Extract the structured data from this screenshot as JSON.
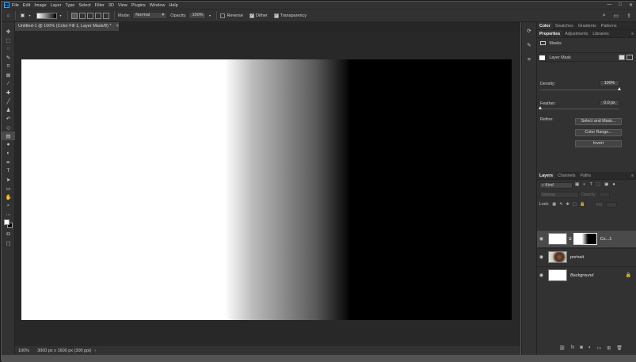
{
  "menu": {
    "logo": "Ps",
    "items": [
      "File",
      "Edit",
      "Image",
      "Layer",
      "Type",
      "Select",
      "Filter",
      "3D",
      "View",
      "Plugins",
      "Window",
      "Help"
    ],
    "window_controls": [
      "—",
      "□",
      "✕"
    ]
  },
  "options": {
    "mode_label": "Mode:",
    "mode_value": "Normal",
    "opacity_label": "Opacity:",
    "opacity_value": "100%",
    "reverse_label": "Reverse",
    "reverse_checked": false,
    "dither_label": "Dither",
    "dither_checked": true,
    "transparency_label": "Transparency",
    "transparency_checked": true
  },
  "document": {
    "tab_title": "Untitled-1 @ 100% (Color Fill 1, Layer Mask/8) *",
    "zoom": "100%",
    "info": "3000 px x 1600 px (300 ppi)",
    "status_arrow": "›"
  },
  "panels": {
    "top_tabs": [
      "Color",
      "Swatches",
      "Gradients",
      "Patterns"
    ],
    "props_tabs": [
      "Properties",
      "Adjustments",
      "Libraries"
    ],
    "masks_label": "Masks",
    "layer_mask_label": "Layer Mask",
    "density_label": "Density:",
    "density_value": "100%",
    "density_fraction": 1.0,
    "feather_label": "Feather:",
    "feather_value": "0.0 px",
    "feather_fraction": 0.0,
    "refine_label": "Refine:",
    "buttons": [
      "Select and Mask...",
      "Color Range...",
      "Invert"
    ]
  },
  "layers_panel": {
    "tabs": [
      "Layers",
      "Channels",
      "Paths"
    ],
    "filter_label": "Kind",
    "blend_mode": "Normal",
    "opacity_label": "Opacity:",
    "opacity_value": "100%",
    "lock_label": "Lock:",
    "fill_label": "Fill:",
    "fill_value": "100%",
    "layers": [
      {
        "name": "Co...1",
        "selected": true,
        "italic": false
      },
      {
        "name": "portrait",
        "selected": false,
        "italic": false
      },
      {
        "name": "Background",
        "selected": false,
        "italic": true,
        "locked": true
      }
    ]
  },
  "colors": {
    "ui_dark": "#323232",
    "pasteboard": "#282828",
    "accent": "#2fa3ff"
  }
}
